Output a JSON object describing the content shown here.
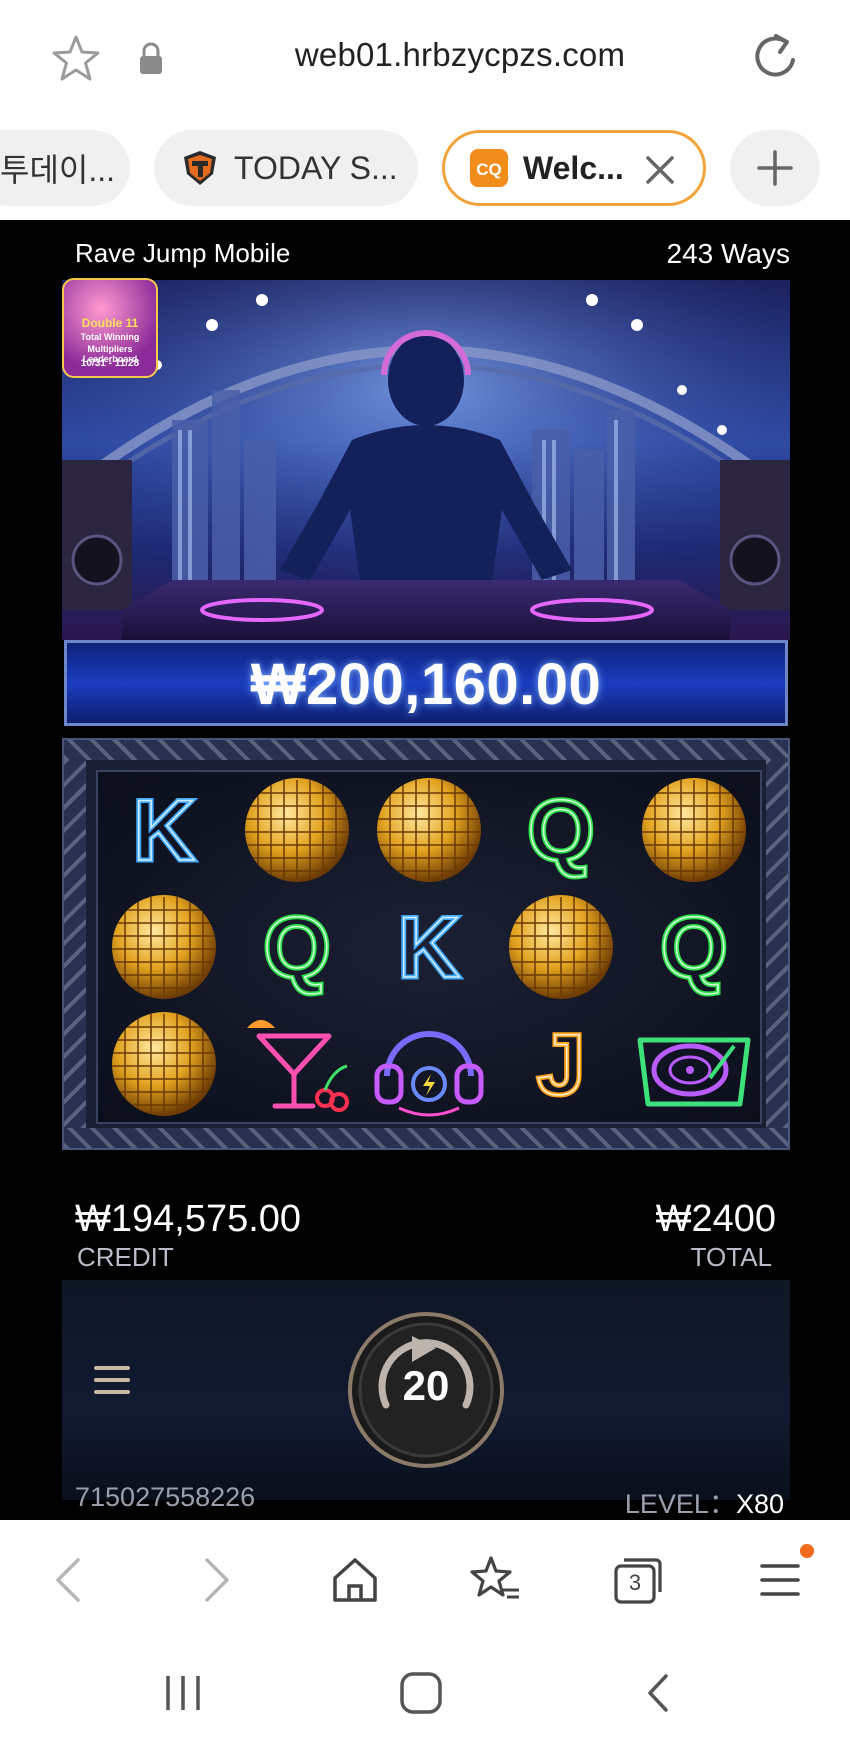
{
  "browser": {
    "url": "web01.hrbzycpzs.com",
    "tabs": [
      {
        "label": "투데이..."
      },
      {
        "label": "TODAY S..."
      },
      {
        "label": "Welc..."
      }
    ],
    "tab_count": "3"
  },
  "game": {
    "title": "Rave Jump Mobile",
    "ways": "243 Ways",
    "promo": {
      "line1": "Double 11",
      "line2": "Total Winning",
      "line3": "Multipliers Leaderboard",
      "dates": "10/31 - 11/28"
    },
    "jackpot": "₩200,160.00",
    "reels": [
      [
        "K",
        "disco-ball",
        "disco-ball"
      ],
      [
        "disco-ball",
        "Q",
        "cocktail"
      ],
      [
        "disco-ball",
        "K",
        "headphones"
      ],
      [
        "Q",
        "disco-ball",
        "J"
      ],
      [
        "disco-ball",
        "Q",
        "turntable"
      ]
    ],
    "credit_value": "₩194,575.00",
    "credit_label": "CREDIT",
    "total_value": "₩2400",
    "total_label": "TOTAL",
    "autospin_count": "20",
    "round_id": "715027558226",
    "level_label": "LEVEL：",
    "level_value": "X80"
  },
  "colors": {
    "active_tab_border": "#f2a33a",
    "notification_dot": "#f26a1b",
    "jackpot_blue": "#1a3cbf"
  }
}
